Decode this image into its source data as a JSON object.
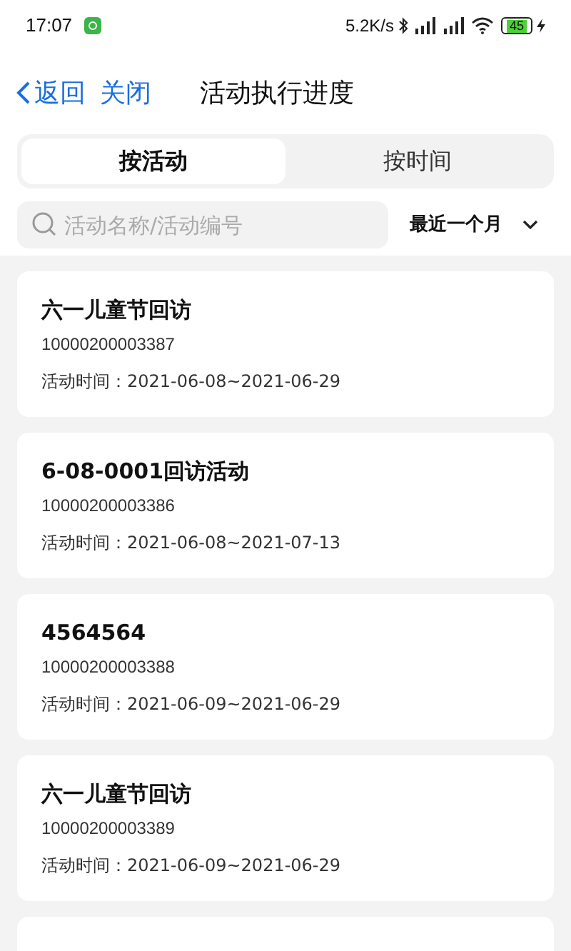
{
  "status_bar": {
    "time": "17:07",
    "net_speed": "5.2K/s",
    "battery": "45"
  },
  "header": {
    "back": "返回",
    "close": "关闭",
    "title": "活动执行进度"
  },
  "tabs": [
    {
      "label": "按活动",
      "selected": true
    },
    {
      "label": "按时间",
      "selected": false
    }
  ],
  "search": {
    "placeholder": "活动名称/活动编号"
  },
  "period_filter": {
    "value": "最近一个月"
  },
  "activities": [
    {
      "name": "六一儿童节回访",
      "code": "10000200003387",
      "time": "活动时间：2021-06-08~2021-06-29"
    },
    {
      "name": "6-08-0001回访活动",
      "code": "10000200003386",
      "time": "活动时间：2021-06-08~2021-07-13"
    },
    {
      "name": "4564564",
      "code": "10000200003388",
      "time": "活动时间：2021-06-09~2021-06-29"
    },
    {
      "name": "六一儿童节回访",
      "code": "10000200003389",
      "time": "活动时间：2021-06-09~2021-06-29"
    }
  ]
}
